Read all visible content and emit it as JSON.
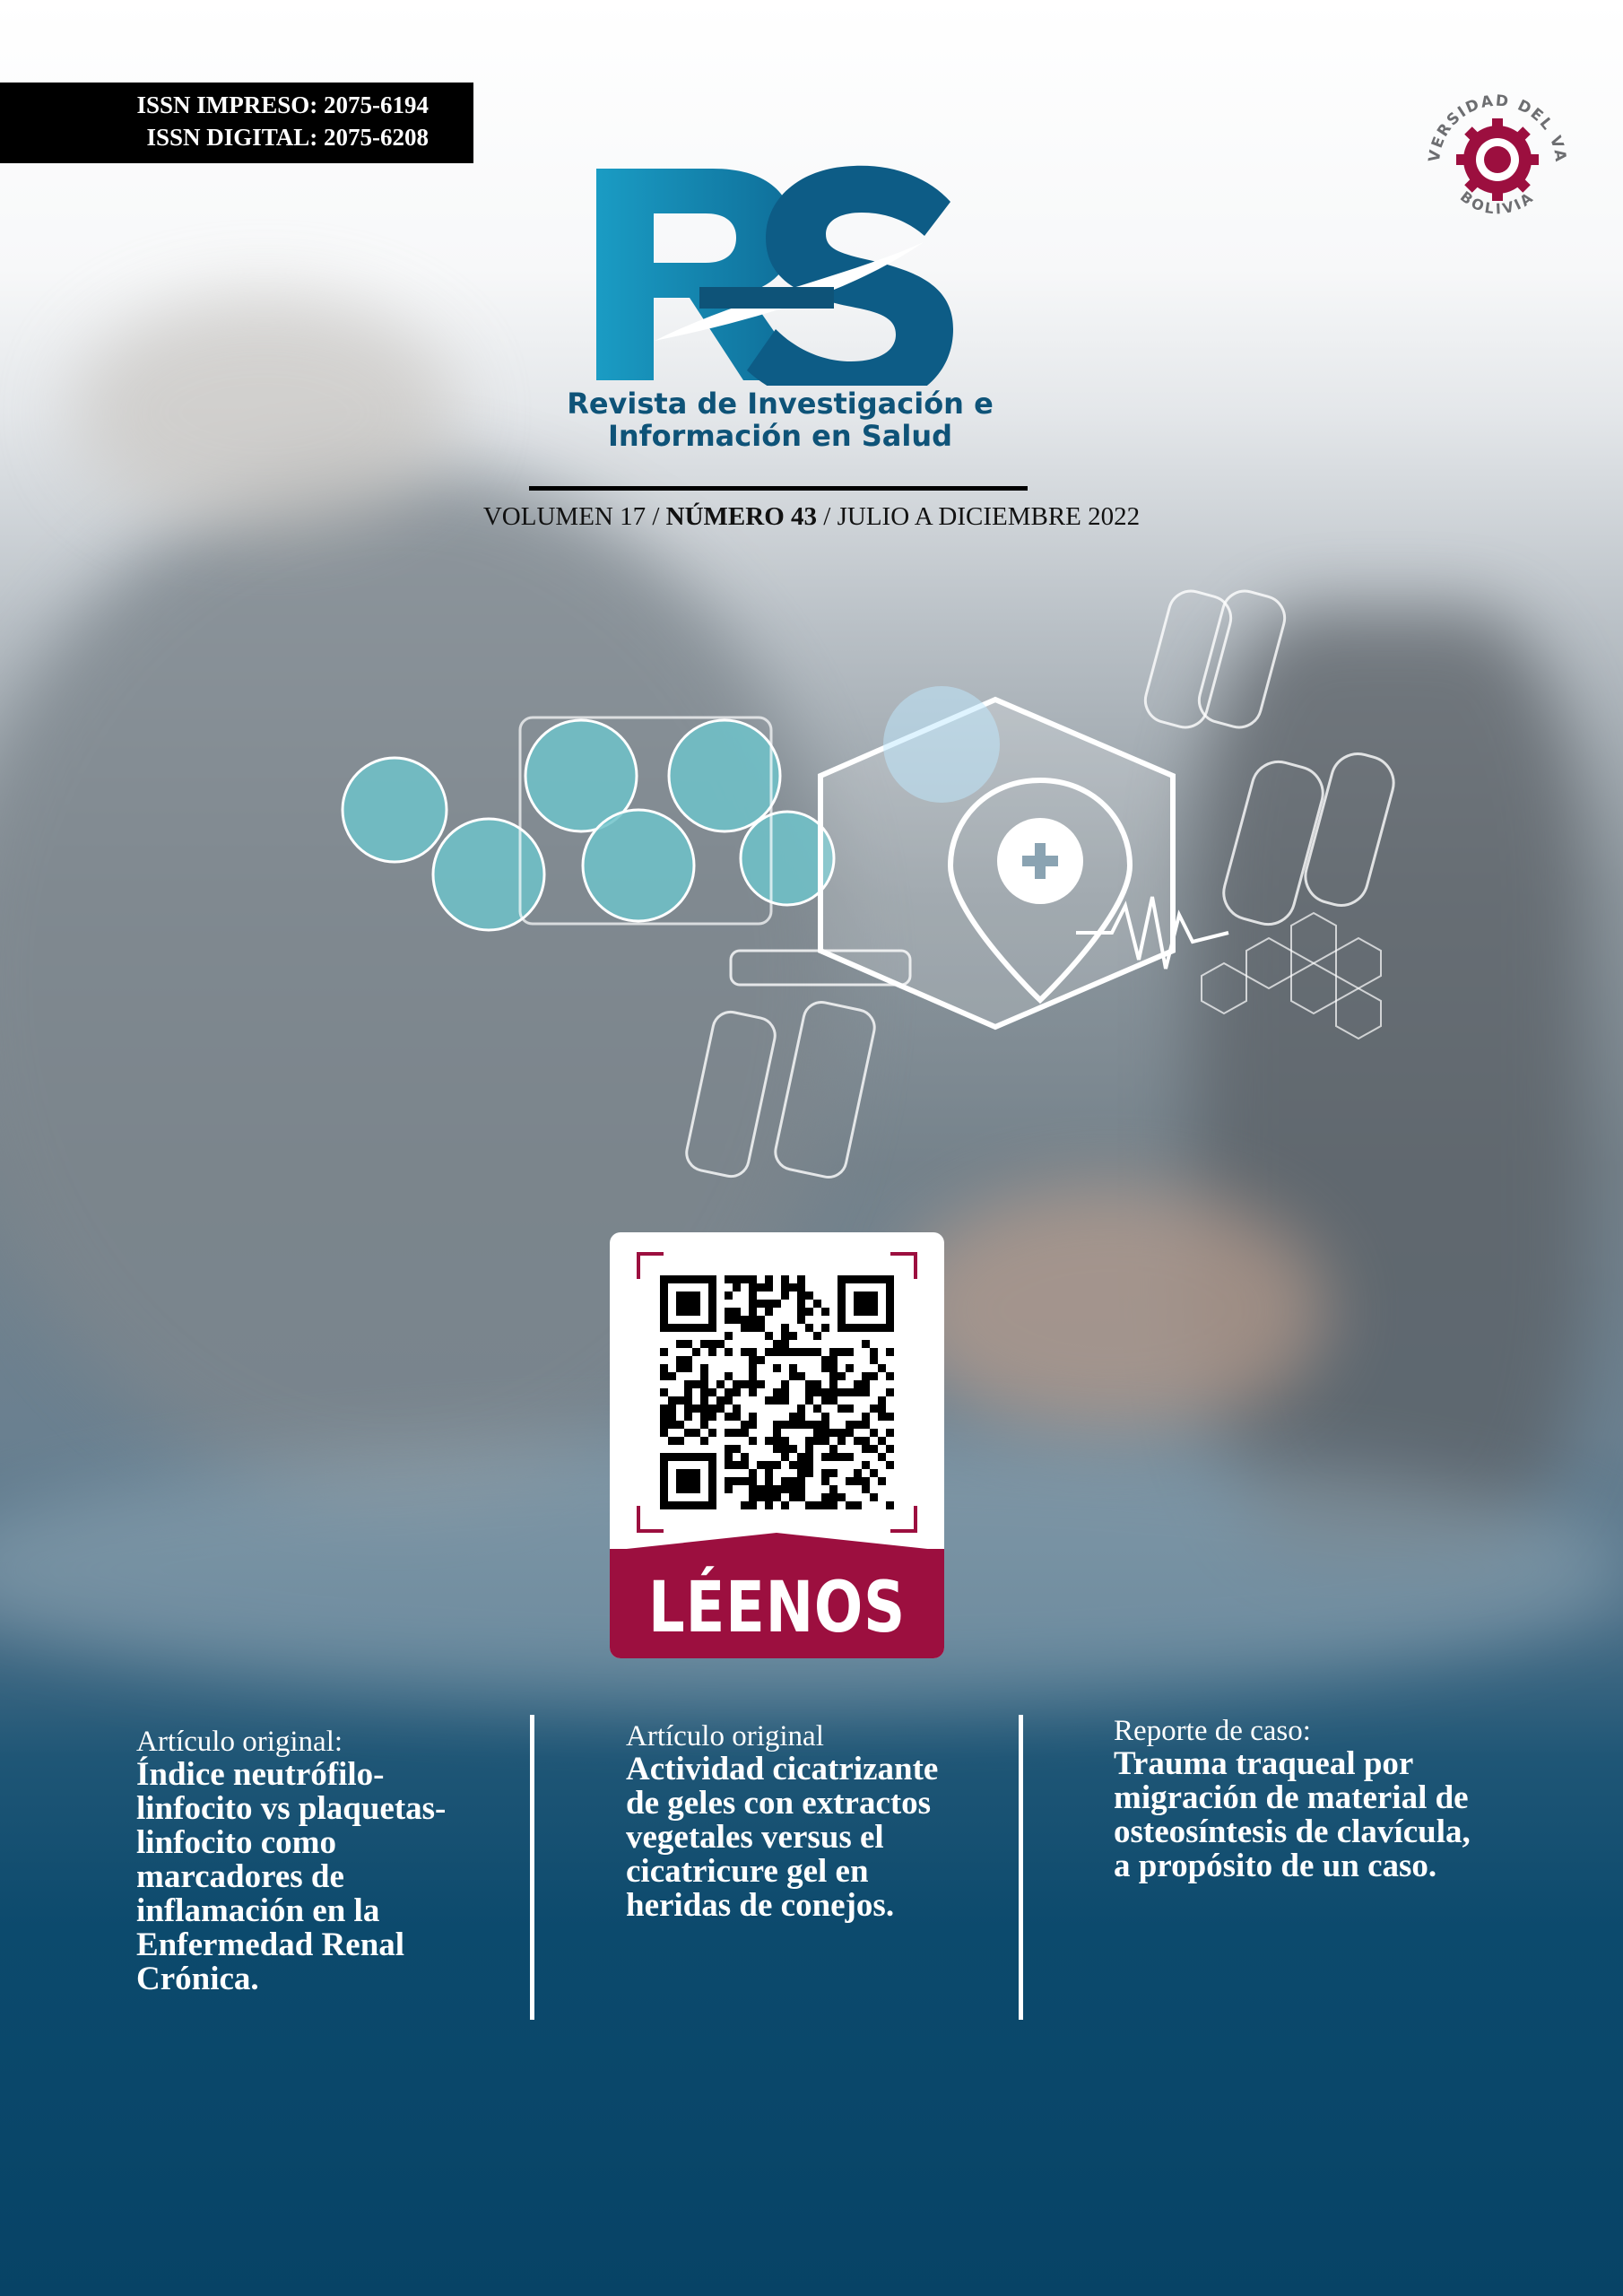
{
  "issn": {
    "print": "ISSN IMPRESO: 2075-6194",
    "digital": "ISSN DIGITAL: 2075-6208"
  },
  "journal": {
    "logo_letters": "RIS",
    "name_line1": "Revista de Investigación e",
    "name_line2": "Información en Salud"
  },
  "issue": {
    "volume": "VOLUMEN 17",
    "separator": "/",
    "number": "NÚMERO 43",
    "period": "JULIO A DICIEMBRE 2022"
  },
  "seal": {
    "top_text": "UNIVERSIDAD DEL VALLE",
    "bottom_text": "BOLIVIA"
  },
  "qr": {
    "label": "LÉENOS"
  },
  "articles": [
    {
      "kind": "Artículo original:",
      "title": "Índice neutrófilo-linfocito vs plaquetas-linfocito como marcadores de inflamación en la Enfermedad Renal Crónica."
    },
    {
      "kind": "Artículo original",
      "title": "Actividad cicatrizante de geles con extractos vegetales versus el cicatricure gel en heridas de conejos."
    },
    {
      "kind": "Reporte de caso:",
      "title": "Trauma traqueal por migración de material de osteosíntesis de clavícula, a propósito de un caso."
    }
  ],
  "colors": {
    "brand_blue": "#0e5378",
    "brand_cyan": "#1a9cc4",
    "seal_red": "#9c0f3f",
    "bottom_navy": "#074366"
  }
}
